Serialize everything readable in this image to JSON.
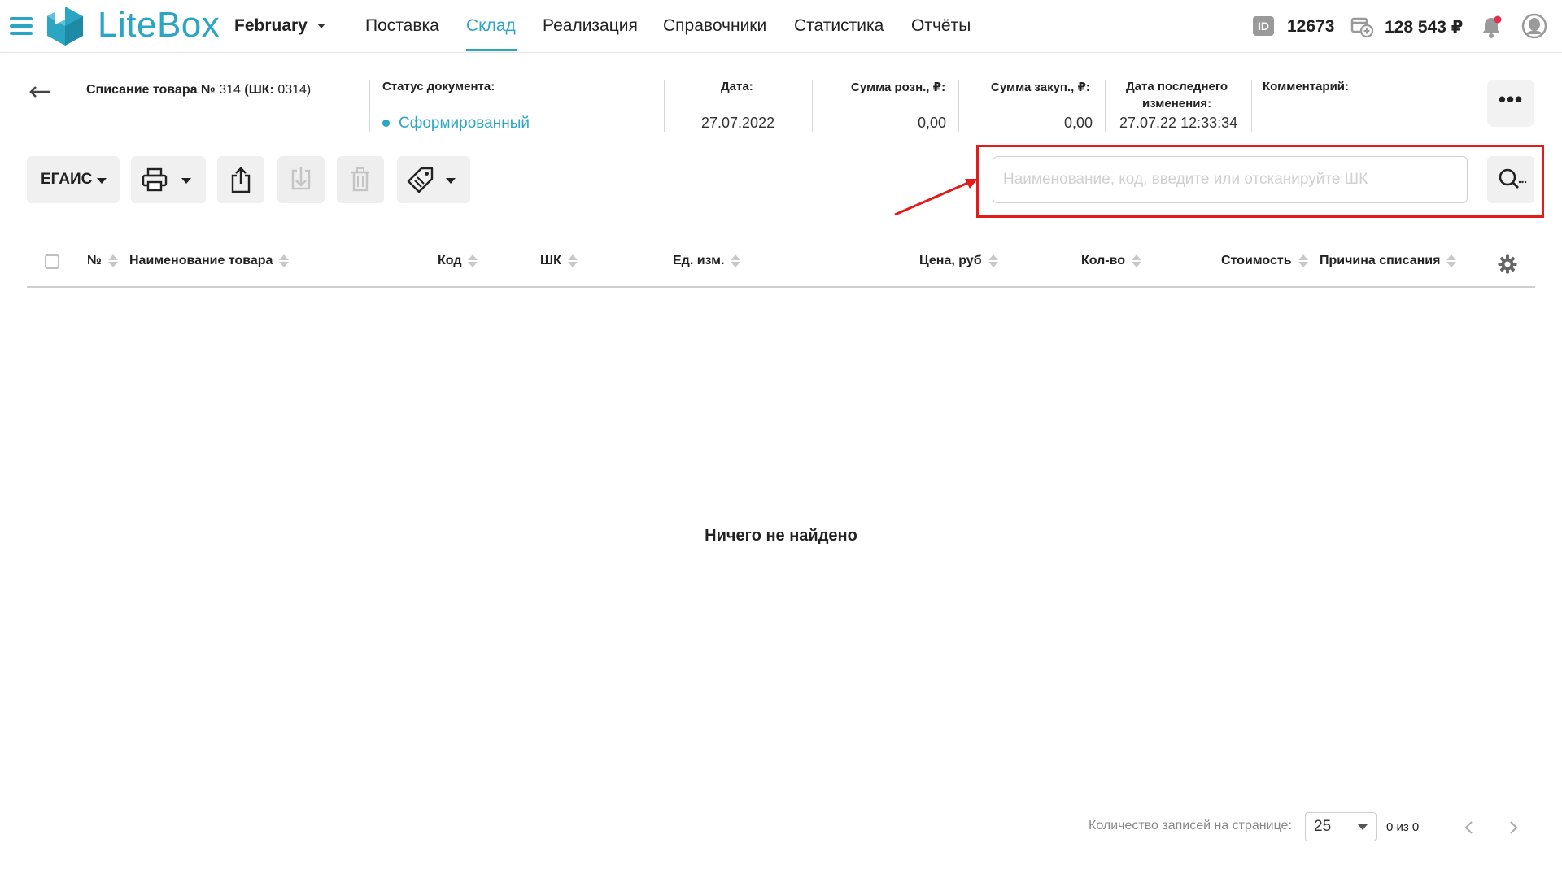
{
  "app": {
    "brand": "LiteBox",
    "company": "February",
    "id_label": "ID",
    "account_id": "12673",
    "balance": "128 543 ₽",
    "colors": {
      "accent": "#2aa6c4",
      "highlight": "#e31b1b",
      "notification": "#e0304e"
    }
  },
  "nav": {
    "items": [
      {
        "label": "Поставка"
      },
      {
        "label": "Склад",
        "active": true
      },
      {
        "label": "Реализация"
      },
      {
        "label": "Справочники"
      },
      {
        "label": "Статистика"
      },
      {
        "label": "Отчёты"
      }
    ]
  },
  "document": {
    "title_bold": "Списание товара №",
    "number": "314",
    "barcode_bold": "(ШК:",
    "barcode_value": "0314)",
    "status_label": "Статус документа:",
    "status_value": "Сформированный",
    "date_label": "Дата:",
    "date_value": "27.07.2022",
    "retail_label": "Сумма розн., ₽:",
    "retail_value": "0,00",
    "purchase_label": "Сумма закуп., ₽:",
    "purchase_value": "0,00",
    "changed_label_1": "Дата последнего",
    "changed_label_2": "изменения:",
    "changed_value": "27.07.22 12:33:34",
    "comment_label": "Комментарий:",
    "more_label": "•••"
  },
  "toolbar": {
    "egais_label": "ЕГАИС",
    "icons": [
      "printer-icon",
      "export-icon",
      "import-icon",
      "trash-icon",
      "price-tag-icon"
    ]
  },
  "search": {
    "placeholder": "Наименование, код, введите или отсканируйте ШК",
    "value": ""
  },
  "table": {
    "columns": [
      "№",
      "Наименование товара",
      "Код",
      "ШК",
      "Ед. изм.",
      "Цена, руб",
      "Кол-во",
      "Стоимость",
      "Причина списания"
    ],
    "rows": [],
    "empty_text": "Ничего не найдено"
  },
  "pagination": {
    "per_page_label": "Количество записей на странице:",
    "per_page_value": "25",
    "page_info": "0 из 0"
  }
}
